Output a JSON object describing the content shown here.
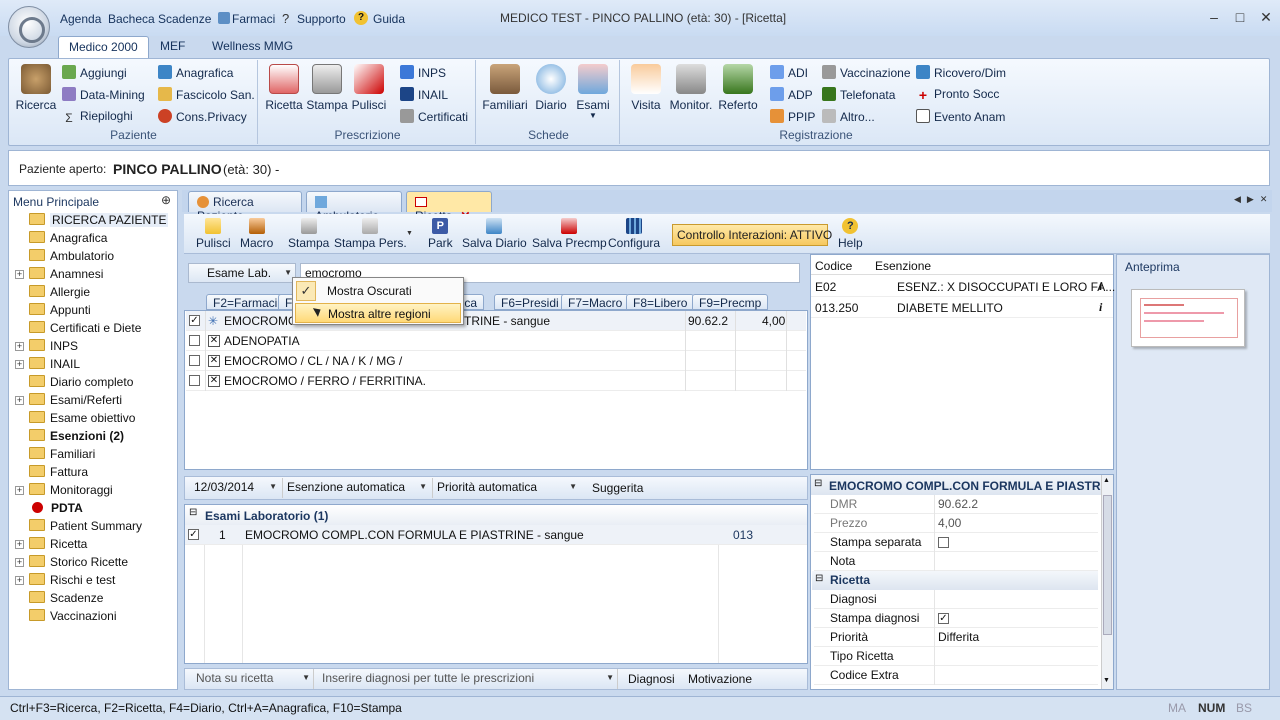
{
  "quick_access": [
    "Agenda",
    "Bacheca",
    "Scadenze",
    "Farmaci",
    "Supporto",
    "Guida"
  ],
  "window_title": "MEDICO TEST - PINCO PALLINO (età: 30)   - [Ricetta]",
  "window_controls": {
    "minimize": "–",
    "maximize": "□",
    "close": "✕"
  },
  "ribbon_tabs": [
    "Medico 2000",
    "MEF",
    "Wellness MMG"
  ],
  "ribbon": {
    "paziente": {
      "label": "Paziente",
      "big": "Ricerca",
      "small": [
        "Aggiungi",
        "Data-Mining",
        "Riepiloghi",
        "Anagrafica",
        "Fascicolo San.",
        "Cons.Privacy"
      ]
    },
    "prescrizione": {
      "label": "Prescrizione",
      "big": [
        "Ricetta",
        "Stampa",
        "Pulisci"
      ],
      "small": [
        "INPS",
        "INAIL",
        "Certificati"
      ]
    },
    "schede": {
      "label": "Schede",
      "big": [
        "Familiari",
        "Diario",
        "Esami"
      ]
    },
    "registrazione": {
      "label": "Registrazione",
      "big": [
        "Visita",
        "Monitor.",
        "Referto"
      ],
      "small": [
        "ADI",
        "ADP",
        "PPIP",
        "Vaccinazione",
        "Telefonata",
        "Altro...",
        "Ricovero/Dim",
        "Pronto Socc",
        "Evento Anam"
      ]
    }
  },
  "patient": {
    "label": "Paziente aperto:",
    "name": "PINCO PALLINO",
    "age": "(età: 30) -"
  },
  "menu": {
    "title": "Menu Principale",
    "pin": "⊕",
    "items": [
      "RICERCA PAZIENTE",
      "Anagrafica",
      "Ambulatorio",
      "Anamnesi",
      "Allergie",
      "Appunti",
      "Certificati e Diete",
      "INPS",
      "INAIL",
      "Diario completo",
      "Esami/Referti",
      "Esame obiettivo",
      "Esenzioni (2)",
      "Familiari",
      "Fattura",
      "Monitoraggi",
      "PDTA",
      "Patient Summary",
      "Ricetta",
      "Storico Ricette",
      "Rischi e test",
      "Scadenze",
      "Vaccinazioni"
    ]
  },
  "doc_tabs": [
    "Ricerca Paziente",
    "Ambulatorio",
    "Ricetta"
  ],
  "doc_tab_close": "✕",
  "doc_tab_nav": [
    "◀",
    "▶",
    "✕"
  ],
  "toolbar": {
    "buttons": [
      "Pulisci",
      "Macro",
      "Stampa",
      "Stampa Pers.",
      "Park",
      "Salva Diario",
      "Salva Precmp",
      "Configura"
    ],
    "interactions": "Controllo Interazioni: ATTIVO",
    "help": "Help"
  },
  "search": {
    "type": "Esame Lab.",
    "query": "emocromo"
  },
  "popup": {
    "items": [
      "Mostra Oscurati",
      "Mostra altre regioni"
    ],
    "check": "✓"
  },
  "fkey_tabs": [
    "F2=Farmaci",
    "F3",
    "nica",
    "F6=Presidi",
    "F7=Macro",
    "F8=Libero",
    "F9=Precmp"
  ],
  "results": [
    {
      "checked": true,
      "mark": "✳",
      "name": "EMOCROMO",
      "tail": "TRINE - sangue",
      "code": "90.62.2",
      "price": "4,00"
    },
    {
      "checked": false,
      "mark": "✕",
      "name": "ADENOPATIA",
      "tail": "",
      "code": "",
      "price": ""
    },
    {
      "checked": false,
      "mark": "✕",
      "name": "EMOCROMO / CL / NA / K / MG /",
      "tail": "",
      "code": "",
      "price": ""
    },
    {
      "checked": false,
      "mark": "✕",
      "name": "EMOCROMO / FERRO / FERRITINA.",
      "tail": "",
      "code": "",
      "price": ""
    }
  ],
  "exemptions": {
    "headers": [
      "Codice",
      "Esenzione"
    ],
    "rows": [
      {
        "code": "E02",
        "desc": "ESENZ.: X DISOCCUPATI E LORO FA..."
      },
      {
        "code": "013.250",
        "desc": "DIABETE MELLITO"
      }
    ],
    "info_icon": "i"
  },
  "preview": {
    "title": "Anteprima"
  },
  "rx_options": {
    "date": "12/03/2014",
    "exemption": "Esenzione automatica",
    "priority": "Priorità automatica",
    "suggest": "Suggerita"
  },
  "rx_group": {
    "title": "Esami Laboratorio (1)",
    "rows": [
      {
        "n": "1",
        "name": "EMOCROMO COMPL.CON FORMULA E PIASTRINE - sangue",
        "code": "013"
      }
    ]
  },
  "properties": {
    "header": "EMOCROMO COMPL.CON FORMULA E PIASTRIN",
    "rows": [
      {
        "k": "DMR",
        "v": "90.62.2",
        "muted": true
      },
      {
        "k": "Prezzo",
        "v": "4,00",
        "muted": true
      },
      {
        "k": "Stampa separata",
        "v": "",
        "check": false
      },
      {
        "k": "Nota",
        "v": ""
      }
    ],
    "section": "Ricetta",
    "rows2": [
      {
        "k": "Diagnosi",
        "v": ""
      },
      {
        "k": "Stampa diagnosi",
        "v": "",
        "check": true
      },
      {
        "k": "Priorità",
        "v": "Differita"
      },
      {
        "k": "Tipo Ricetta",
        "v": ""
      },
      {
        "k": "Codice Extra",
        "v": ""
      }
    ]
  },
  "bottom": {
    "note": "Nota su ricetta",
    "diag_placeholder": "Inserire diagnosi per tutte le prescrizioni",
    "diagnosi": "Diagnosi",
    "motivazione": "Motivazione"
  },
  "status": {
    "shortcuts": "Ctrl+F3=Ricerca, F2=Ricetta, F4=Diario, Ctrl+A=Anagrafica, F10=Stampa",
    "indicators": [
      "MA",
      "NUM",
      "BS"
    ]
  }
}
